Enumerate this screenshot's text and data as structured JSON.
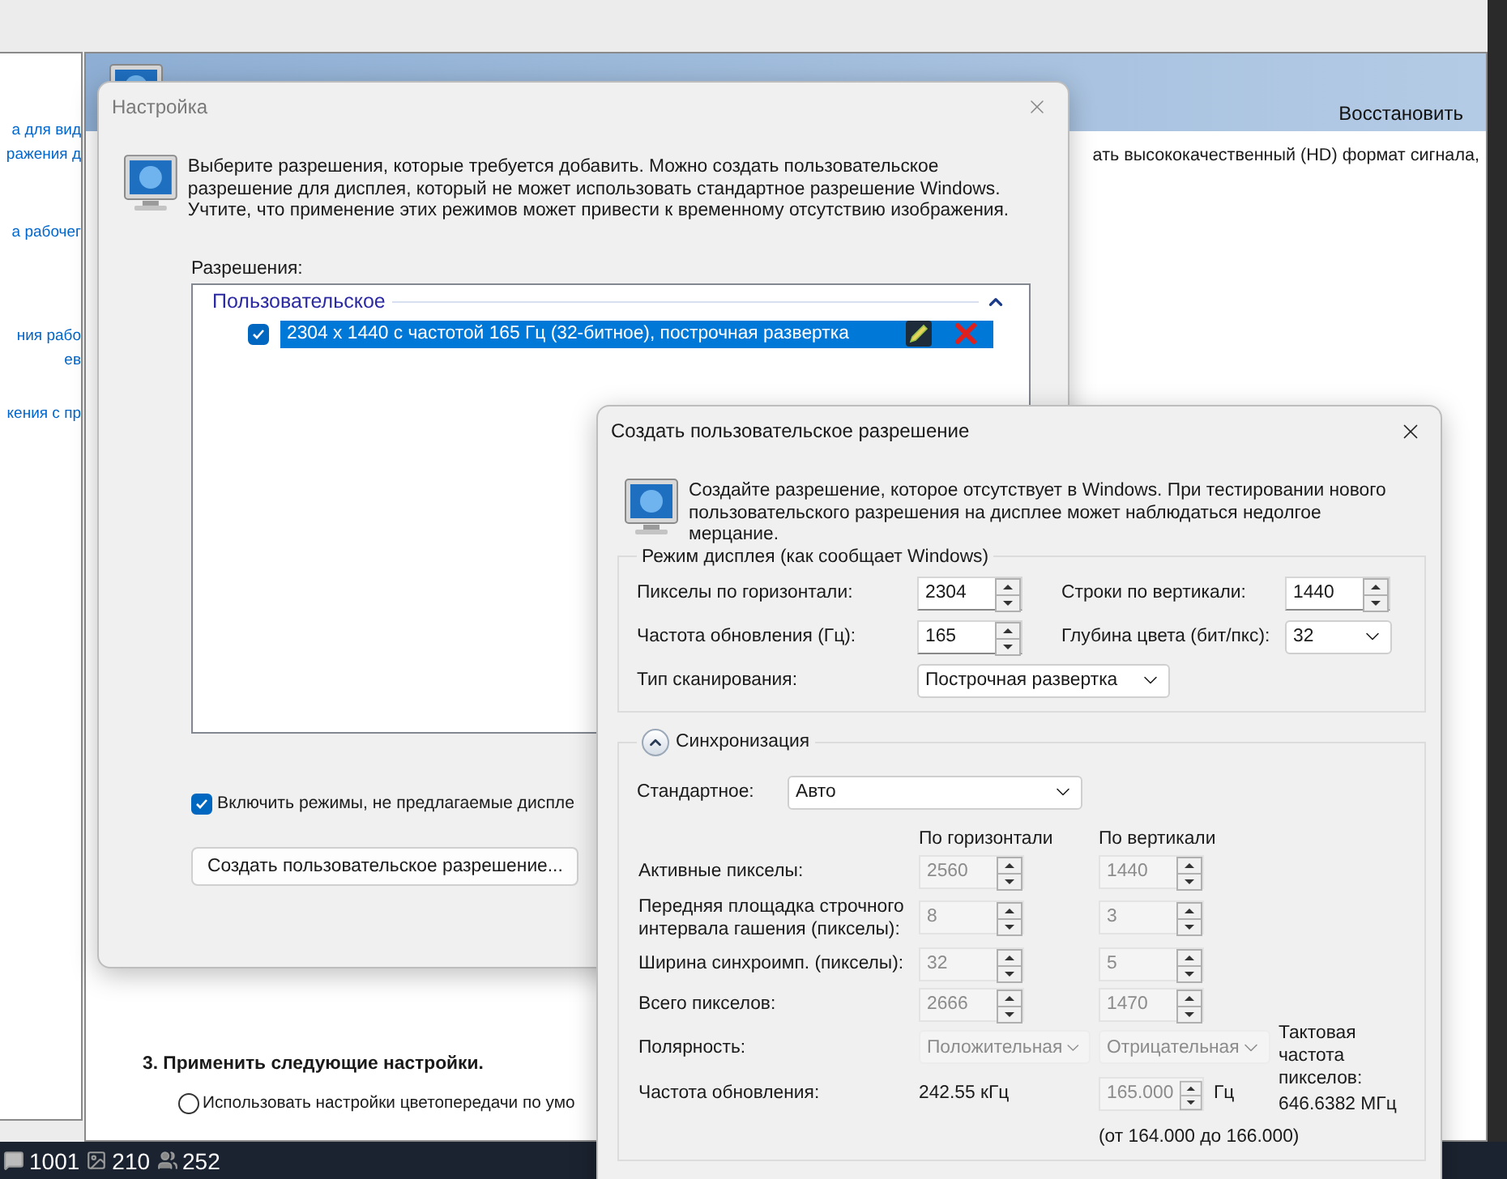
{
  "side_window": {
    "links": [
      "а для вид",
      "ражения д",
      "а рабочег",
      "ния рабо",
      "ев",
      "кения с пр"
    ]
  },
  "main_window": {
    "restore_link": "Восстановить",
    "description": "ать высококачественный (HD) формат сигнала,",
    "section_heading": "3. Применить следующие настройки.",
    "radio_options": [
      {
        "label": "Использовать настройки цветопередачи по умо",
        "selected": false
      }
    ]
  },
  "settings_dialog": {
    "title": "Настройка",
    "message": "Выберите разрешения, которые требуется добавить. Можно создать пользовательское разрешение для дисплея, который не может использовать стандартное разрешение Windows. Учтите, что применение этих режимов может привести к временному отсутствию изображения.",
    "list_label": "Разрешения:",
    "groups": [
      {
        "label": "Пользовательское",
        "expanded": true,
        "items": [
          {
            "label": "2304 x 1440 с частотой 165 Гц (32-битное), построчная развертка",
            "checked": true,
            "selected": true
          }
        ]
      }
    ],
    "include_option": {
      "label": "Включить режимы, не предлагаемые диспле",
      "checked": true
    },
    "create_button": "Создать пользовательское разрешение..."
  },
  "custom_dialog": {
    "title": "Создать пользовательское разрешение",
    "message": "Создайте разрешение, которое отсутствует в Windows. При тестировании нового пользовательского разрешения на дисплее может наблюдаться недолгое мерцание.",
    "display_mode": {
      "legend": "Режим дисплея (как сообщает Windows)",
      "fields": [
        {
          "kind": "spin",
          "label": "Пикселы по горизонтали:",
          "value": "2304"
        },
        {
          "kind": "spin",
          "label": "Строки по вертикали:",
          "value": "1440"
        },
        {
          "kind": "spin",
          "label": "Частота обновления (Гц):",
          "value": "165"
        },
        {
          "kind": "select",
          "label": "Глубина цвета (бит/пкс):",
          "value": "32"
        },
        {
          "kind": "wide_select",
          "label": "Тип сканирования:",
          "value": "Построчная развертка"
        }
      ]
    },
    "timing": {
      "legend": "Синхронизация",
      "expanded": true,
      "standard_label": "Стандартное:",
      "standard_value": "Авто",
      "columns": [
        "По горизонтали",
        "По вертикали"
      ],
      "rows": [
        {
          "label": "Активные пикселы:",
          "horizontal": "2560",
          "vertical": "1440",
          "disabled": true
        },
        {
          "label": "Передняя площадка строчного интервала гашения (пикселы):",
          "horizontal": "8",
          "vertical": "3",
          "disabled": true
        },
        {
          "label": "Ширина синхроимп. (пикселы):",
          "horizontal": "32",
          "vertical": "5",
          "disabled": true
        },
        {
          "label": "Всего пикселов:",
          "horizontal": "2666",
          "vertical": "1470",
          "disabled": true
        }
      ],
      "polarity": {
        "label": "Полярность:",
        "horizontal": "Положительная",
        "vertical": "Отрицательная",
        "disabled": true
      },
      "refresh": {
        "label": "Частота обновления:",
        "horizontal": "242.55 кГц",
        "vertical": "165.000",
        "unit": "Гц",
        "range": "(от 164.000 до 166.000)",
        "disabled": true
      },
      "pixel_clock": {
        "label": "Тактовая частота пикселов:",
        "value": "646.6382 МГц"
      }
    }
  },
  "taskbar": {
    "counters": [
      {
        "kind": "messages",
        "value": "1001"
      },
      {
        "kind": "images",
        "value": "210"
      },
      {
        "kind": "users",
        "value": "252"
      }
    ]
  }
}
